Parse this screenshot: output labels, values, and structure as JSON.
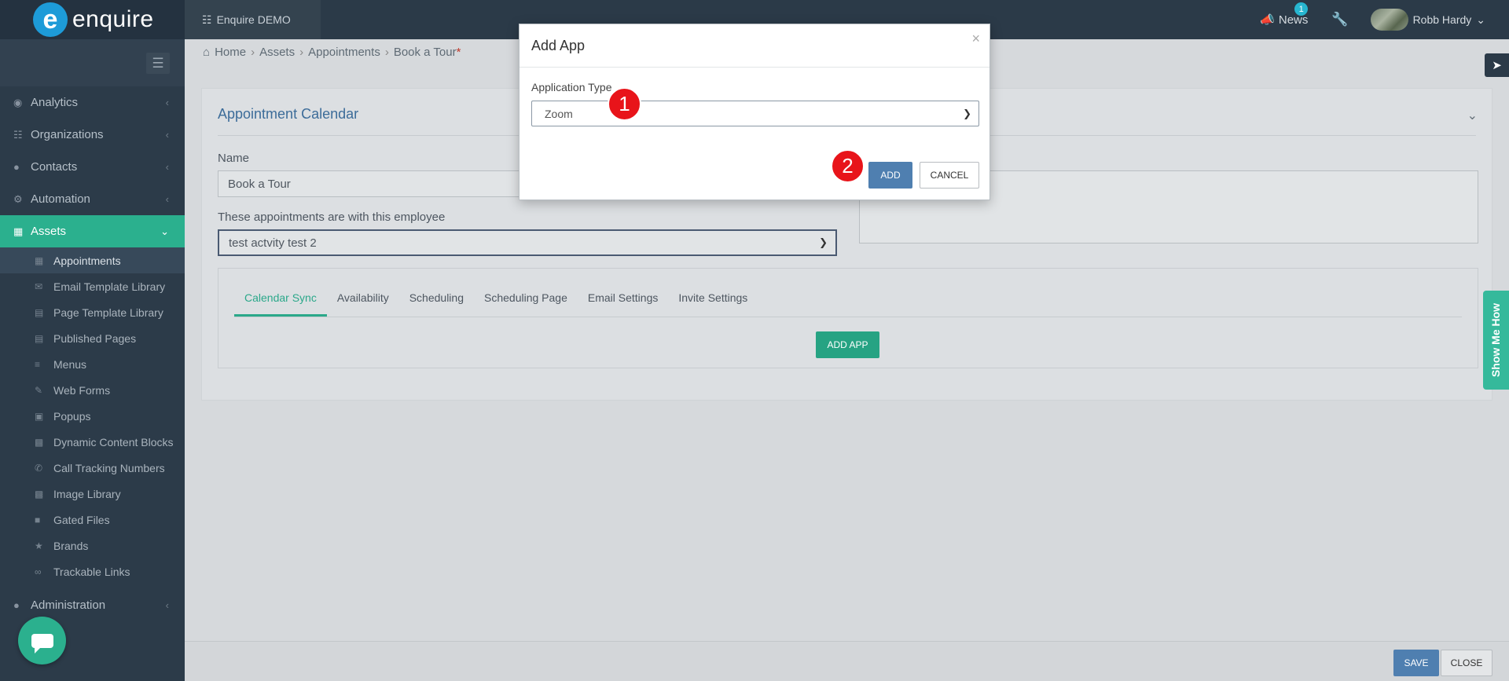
{
  "app": {
    "logo_mark": "e",
    "logo_text": "enquire",
    "account": "Enquire DEMO"
  },
  "topbar": {
    "news_label": "News",
    "news_count": "1",
    "user_name": "Robb Hardy"
  },
  "sidebar": {
    "items": [
      {
        "label": "Analytics",
        "icon": "analytics-icon"
      },
      {
        "label": "Organizations",
        "icon": "sitemap-icon"
      },
      {
        "label": "Contacts",
        "icon": "users-icon"
      },
      {
        "label": "Automation",
        "icon": "gears-icon"
      },
      {
        "label": "Assets",
        "icon": "grid-icon"
      }
    ],
    "sub_items": [
      "Appointments",
      "Email Template Library",
      "Page Template Library",
      "Published Pages",
      "Menus",
      "Web Forms",
      "Popups",
      "Dynamic Content Blocks",
      "Call Tracking Numbers",
      "Image Library",
      "Gated Files",
      "Brands",
      "Trackable Links"
    ],
    "admin_label": "Administration"
  },
  "breadcrumb": {
    "home": "Home",
    "assets": "Assets",
    "appointments": "Appointments",
    "current": "Book a Tour",
    "required_mark": "*"
  },
  "card": {
    "title": "Appointment Calendar",
    "name_label": "Name",
    "name_value": "Book a Tour",
    "employee_label": "These appointments are with this employee",
    "employee_value": "test actvity test 2",
    "tabs": [
      "Calendar Sync",
      "Availability",
      "Scheduling",
      "Scheduling Page",
      "Email Settings",
      "Invite Settings"
    ],
    "add_app_label": "ADD APP"
  },
  "show_me_how": "Show Me How",
  "footer": {
    "save": "SAVE",
    "close": "CLOSE"
  },
  "modal": {
    "title": "Add App",
    "close": "×",
    "type_label": "Application Type",
    "type_value": "Zoom",
    "add": "ADD",
    "cancel": "CANCEL"
  },
  "markers": [
    "1",
    "2"
  ]
}
